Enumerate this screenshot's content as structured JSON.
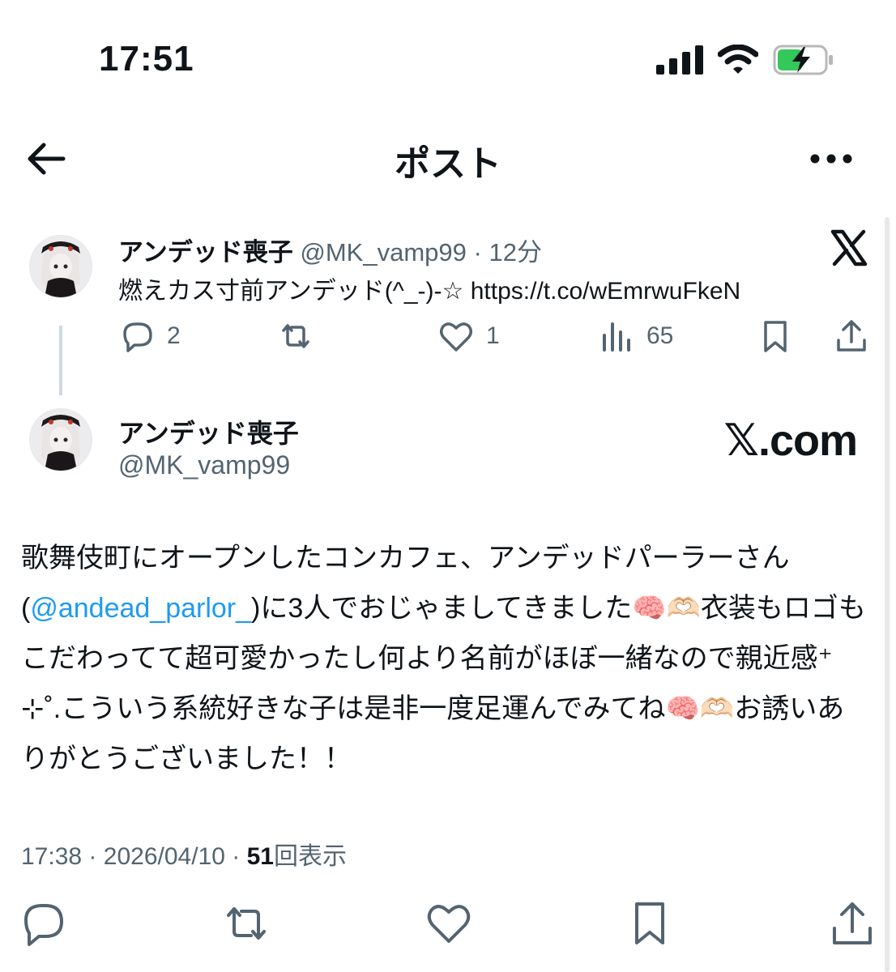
{
  "status_bar": {
    "time": "17:51",
    "icons": [
      "signal-icon",
      "wifi-icon",
      "battery-charging-icon"
    ]
  },
  "nav": {
    "title": "ポスト",
    "back_icon": "arrow-left-icon",
    "more_icon": "more-icon"
  },
  "quoted_post": {
    "display_name": "アンデッド喪子",
    "handle": "@MK_vamp99",
    "time_ago": "12分",
    "separator": "·",
    "text": "燃えカス寸前アンデッド(^_-)-☆ https://t.co/wEmrwuFkeN",
    "brand_icon": "x-logo-icon",
    "actions": {
      "reply_count": "2",
      "repost_count": "",
      "like_count": "1",
      "views_count": "65"
    }
  },
  "main_post": {
    "display_name": "アンデッド喪子",
    "handle": "@MK_vamp99",
    "watermark": "𝕏.com",
    "text_before_mention": "歌舞伎町にオープンしたコンカフェ、アンデッドパーラーさん(",
    "mention": "@andead_parlor_",
    "text_after_mention": ")に3人でおじゃましてきました🧠🫶🏻衣装もロゴもこだわってて超可愛かったし何より名前がほぼ一緒なので親近感⁺ ⊹˚.こういう系統好きな子は是非一度足運んでみてね🧠🫶🏻お誘いありがとうございました！！",
    "meta": {
      "time": "17:38",
      "date": "2026/04/10",
      "separator": "·",
      "views": "51",
      "views_label": "回表示"
    }
  },
  "colors": {
    "text": "#0f1419",
    "muted": "#536471",
    "accent": "#1d9bf0",
    "battery_green": "#34c759"
  }
}
